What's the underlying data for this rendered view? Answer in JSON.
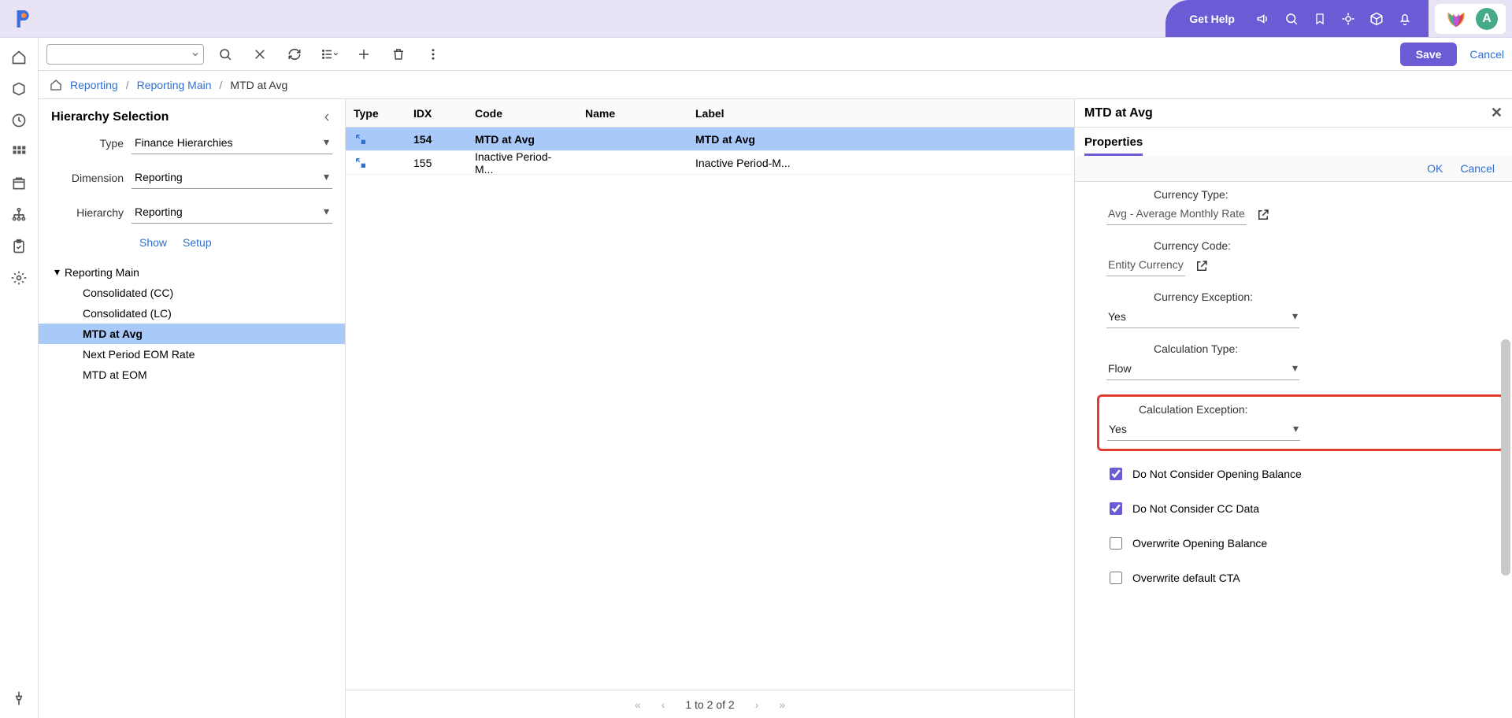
{
  "brand": {
    "avatar_initial": "A",
    "get_help": "Get Help"
  },
  "toolbar": {
    "save": "Save",
    "cancel": "Cancel"
  },
  "breadcrumbs": {
    "items": [
      "Reporting",
      "Reporting Main"
    ],
    "current": "MTD at Avg"
  },
  "hierarchy_panel": {
    "title": "Hierarchy Selection",
    "fields": {
      "type": {
        "label": "Type",
        "value": "Finance Hierarchies"
      },
      "dimension": {
        "label": "Dimension",
        "value": "Reporting"
      },
      "hierarchy": {
        "label": "Hierarchy",
        "value": "Reporting"
      }
    },
    "links": {
      "show": "Show",
      "setup": "Setup"
    },
    "tree": {
      "root": "Reporting Main",
      "children": [
        "Consolidated (CC)",
        "Consolidated (LC)",
        "MTD at Avg",
        "Next Period EOM Rate",
        "MTD at EOM"
      ],
      "selected": "MTD at Avg"
    }
  },
  "grid": {
    "columns": {
      "type": "Type",
      "idx": "IDX",
      "code": "Code",
      "name": "Name",
      "label": "Label"
    },
    "rows": [
      {
        "idx": "154",
        "code": "MTD at Avg",
        "name": "",
        "label": "MTD at Avg",
        "selected": true
      },
      {
        "idx": "155",
        "code": "Inactive Period-M...",
        "name": "",
        "label": "Inactive Period-M...",
        "selected": false
      }
    ],
    "pager": "1 to 2 of 2"
  },
  "properties": {
    "title": "MTD at Avg",
    "tab": "Properties",
    "actions": {
      "ok": "OK",
      "cancel": "Cancel"
    },
    "fields": {
      "currency_type": {
        "label": "Currency Type:",
        "value": "Avg - Average Monthly Rate",
        "kind": "link"
      },
      "currency_code": {
        "label": "Currency Code:",
        "value": "Entity Currency",
        "kind": "link"
      },
      "currency_exception": {
        "label": "Currency Exception:",
        "value": "Yes",
        "kind": "select"
      },
      "calculation_type": {
        "label": "Calculation Type:",
        "value": "Flow",
        "kind": "select"
      },
      "calculation_exception": {
        "label": "Calculation Exception:",
        "value": "Yes",
        "kind": "select",
        "highlighted": true
      }
    },
    "checkboxes": [
      {
        "label": "Do Not Consider Opening Balance",
        "checked": true
      },
      {
        "label": "Do Not Consider CC Data",
        "checked": true
      },
      {
        "label": "Overwrite Opening Balance",
        "checked": false
      },
      {
        "label": "Overwrite default CTA",
        "checked": false
      }
    ]
  }
}
